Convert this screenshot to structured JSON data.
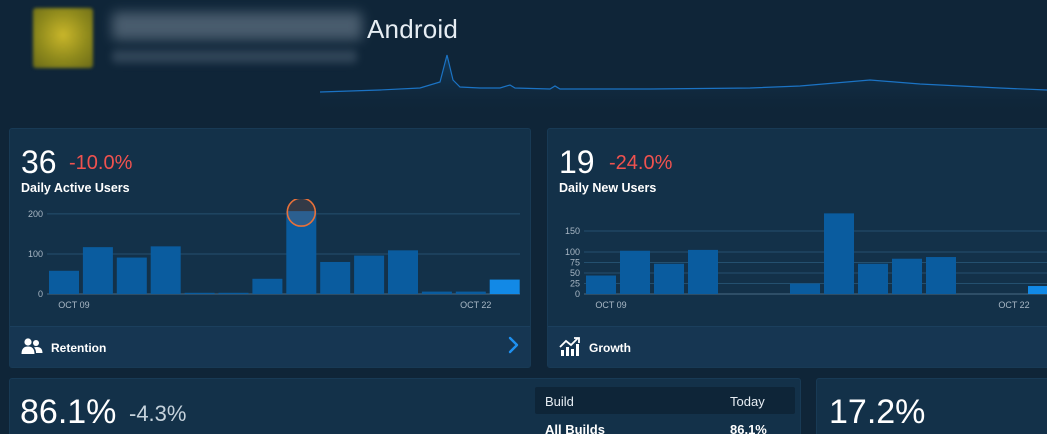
{
  "header": {
    "platform": "Android"
  },
  "colors": {
    "background": "#0f2538",
    "card": "#133149",
    "bar": "#0a5c9f",
    "bar_highlight": "#1289e6",
    "negative": "#f0524f",
    "highlight_ring": "#e8713a"
  },
  "dau": {
    "value": "36",
    "delta": "-10.0%",
    "title": "Daily Active Users",
    "footer_label": "Retention",
    "footer_icon": "users-icon",
    "chart_data": {
      "type": "bar",
      "x_labels": [
        "OCT 09",
        "OCT 22"
      ],
      "y_ticks": [
        0,
        100,
        200
      ],
      "ylim": [
        0,
        220
      ],
      "values": [
        58,
        117,
        91,
        119,
        3,
        3,
        38,
        207,
        80,
        96,
        109,
        6,
        6,
        36
      ],
      "highlight_index": 13,
      "hover_index": 7
    }
  },
  "dnu": {
    "value": "19",
    "delta": "-24.0%",
    "title": "Daily New Users",
    "footer_label": "Growth",
    "footer_icon": "growth-chart-icon",
    "chart_data": {
      "type": "bar",
      "x_labels": [
        "OCT 09",
        "OCT 22"
      ],
      "y_ticks": [
        0,
        25,
        50,
        75,
        100,
        150
      ],
      "ylim": [
        0,
        170
      ],
      "values": [
        44,
        103,
        72,
        105,
        0,
        0,
        25,
        192,
        72,
        84,
        88,
        0,
        0,
        19
      ],
      "highlight_index": 13
    }
  },
  "retention_card": {
    "value": "86.1%",
    "delta": "-4.3%",
    "table": {
      "headers": [
        "Build",
        "Today"
      ],
      "rows": [
        {
          "build": "All Builds",
          "today": "86.1%"
        }
      ]
    }
  },
  "right_card": {
    "value": "17.2%"
  }
}
